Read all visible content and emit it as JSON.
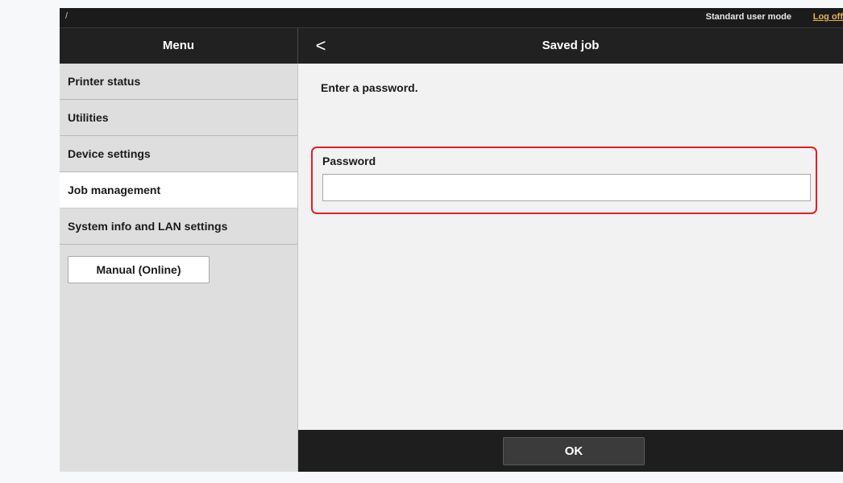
{
  "topbar": {
    "slash": "/",
    "mode_label": "Standard user mode",
    "logout_label": "Log off"
  },
  "header": {
    "menu_title": "Menu",
    "back_icon": "chevron-left-icon",
    "back_glyph": "<",
    "page_title": "Saved job"
  },
  "sidebar": {
    "items": [
      {
        "label": "Printer status",
        "active": false
      },
      {
        "label": "Utilities",
        "active": false
      },
      {
        "label": "Device settings",
        "active": false
      },
      {
        "label": "Job management",
        "active": true
      },
      {
        "label": "System info and LAN settings",
        "active": false
      }
    ],
    "manual_button": "Manual (Online)"
  },
  "main": {
    "prompt": "Enter a password.",
    "password_label": "Password",
    "password_value": "",
    "highlight_color": "#e41d25"
  },
  "footer": {
    "ok_label": "OK"
  }
}
